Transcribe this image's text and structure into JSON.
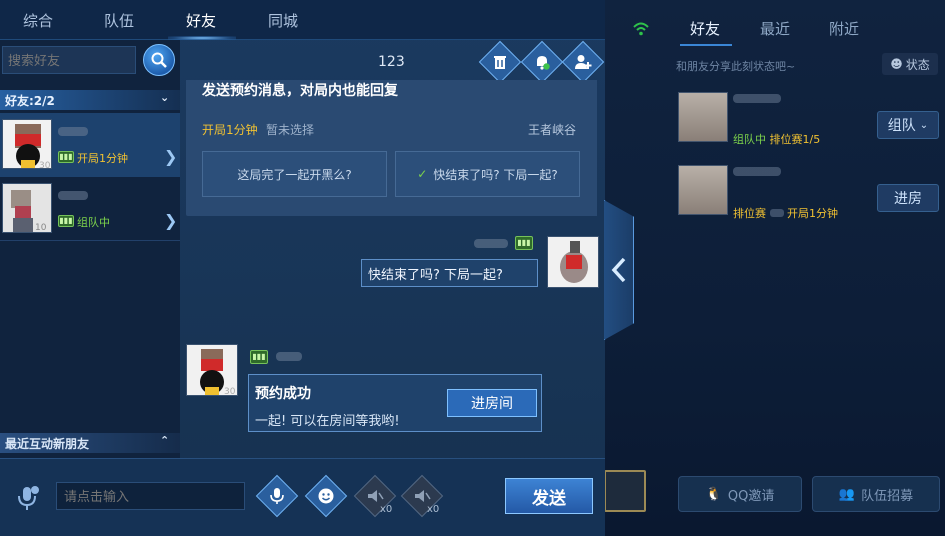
{
  "top_tabs": [
    "综合",
    "队伍",
    "好友",
    "同城"
  ],
  "search": {
    "placeholder": "搜索好友"
  },
  "friends_header": {
    "label": "好友:2/2"
  },
  "friends": [
    {
      "status": "开局1分钟",
      "level_color": "#f1c232"
    },
    {
      "status": "组队中",
      "level_color": "#7dd34b"
    }
  ],
  "recent_section": {
    "label": "最近互动新朋友"
  },
  "chat": {
    "title": "123",
    "invite_card": {
      "title": "发送预约消息，对局内也能回复",
      "time": "开局1分钟",
      "selection": "暂未选择",
      "map": "王者峡谷",
      "quick_replies": [
        "这局完了一起开黑么?",
        "快结束了吗? 下局一起?"
      ]
    },
    "outgoing_message": "快结束了吗? 下局一起?",
    "incoming_card": {
      "title": "预约成功",
      "body": "一起! 可以在房间等我哟!",
      "button": "进房间"
    }
  },
  "bottom_bar": {
    "input_placeholder": "请点击输入",
    "quick_counts": [
      "x0",
      "x0"
    ],
    "send_label": "发送"
  },
  "right_panel": {
    "tabs": [
      "好友",
      "最近",
      "附近"
    ],
    "share_hint": "和朋友分享此刻状态吧~",
    "status_button": "状态",
    "friends": [
      {
        "status_a": "组队中",
        "status_b": "排位赛1/5",
        "button": "组队"
      },
      {
        "status_a": "排位赛",
        "status_b": "开局1分钟",
        "button": "进房"
      }
    ],
    "bottom_buttons": [
      "QQ邀请",
      "队伍招募"
    ]
  }
}
